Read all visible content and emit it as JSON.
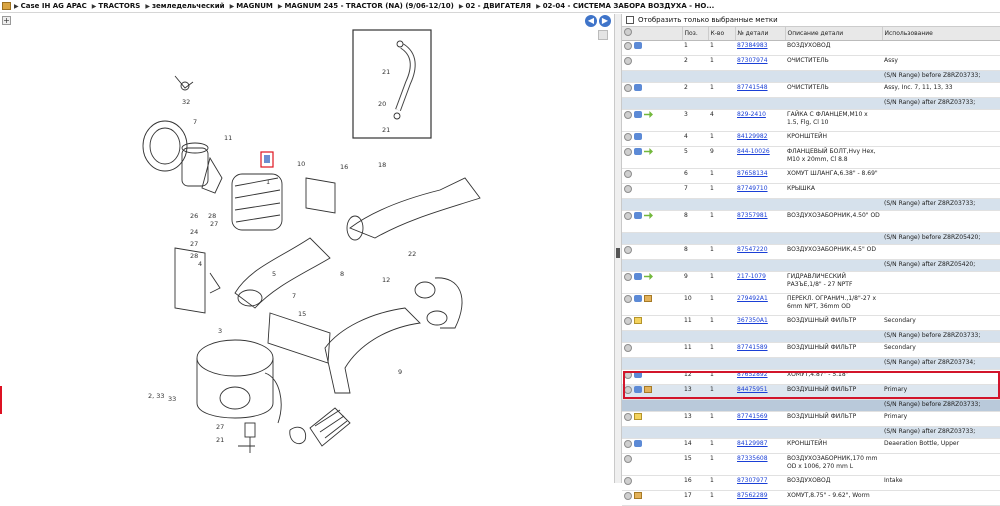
{
  "breadcrumb": {
    "items": [
      "Case IH AG APAC",
      "TRACTORS",
      "земледельческий",
      "MAGNUM",
      "MAGNUM 245 - TRACTOR (NA) (9/06-12/10)",
      "02 - ДВИГАТЕЛЯ",
      "02-04 - СИСТЕМА ЗАБОРА ВОЗДУХА - НО..."
    ]
  },
  "diagram": {
    "labels": [
      "32",
      "7",
      "11",
      "1",
      "10",
      "16",
      "18",
      "8",
      "26",
      "24",
      "27",
      "28",
      "12",
      "22",
      "9",
      "7",
      "33",
      "3",
      "15",
      "27",
      "21",
      "5",
      "4",
      "2, 33",
      "21",
      "20",
      "21",
      "28",
      "27"
    ],
    "selected_ref": "1"
  },
  "filter": {
    "label": "Отобразить только выбранные метки"
  },
  "table": {
    "headers": [
      "",
      "Поз.",
      "К-во",
      "№ детали",
      "Описание детали",
      "Использование"
    ],
    "rows": [
      {
        "icons": [
          "add",
          "sw"
        ],
        "pos": "1",
        "qty": "1",
        "part": "87384983",
        "desc": "ВОЗДУХОВОД",
        "use": "",
        "type": "row"
      },
      {
        "icons": [
          "add"
        ],
        "pos": "2",
        "qty": "1",
        "part": "87307974",
        "desc": "ОЧИСТИТЕЛЬ",
        "use": "Assy",
        "type": "row"
      },
      {
        "type": "note",
        "text": "(S/N Range) before Z8RZ03733;"
      },
      {
        "icons": [
          "add",
          "sw"
        ],
        "pos": "2",
        "qty": "1",
        "part": "87741548",
        "desc": "ОЧИСТИТЕЛЬ",
        "use": "Assy, Inc. 7, 11, 13, 33",
        "type": "row"
      },
      {
        "type": "note",
        "text": "(S/N Range) after Z8RZ03733;"
      },
      {
        "icons": [
          "add",
          "sw",
          "up"
        ],
        "pos": "3",
        "qty": "4",
        "part": "829-2410",
        "desc": "ГАЙКА С ФЛАНЦЕМ,M10 x 1.5, Flg, Cl 10",
        "use": "",
        "type": "row two"
      },
      {
        "icons": [
          "add",
          "sw"
        ],
        "pos": "4",
        "qty": "1",
        "part": "84129982",
        "desc": "КРОНШТЕЙН",
        "use": "",
        "type": "row"
      },
      {
        "icons": [
          "add",
          "sw",
          "up"
        ],
        "pos": "5",
        "qty": "9",
        "part": "844-10026",
        "desc": "ФЛАНЦЕВЫЙ БОЛТ,Hvy Hex, M10 x 20mm, Cl 8.8",
        "use": "",
        "type": "row two"
      },
      {
        "icons": [
          "add"
        ],
        "pos": "6",
        "qty": "1",
        "part": "87658134",
        "desc": "ХОМУТ ШЛАНГА,6.38\" - 8.69\"",
        "use": "",
        "type": "row"
      },
      {
        "icons": [
          "add"
        ],
        "pos": "7",
        "qty": "1",
        "part": "87749710",
        "desc": "КРЫШКА",
        "use": "",
        "type": "row"
      },
      {
        "type": "note",
        "text": "(S/N Range) after Z8RZ03733;"
      },
      {
        "icons": [
          "add",
          "sw",
          "up"
        ],
        "pos": "8",
        "qty": "1",
        "part": "87357981",
        "desc": "ВОЗДУХОЗАБОРНИК,4.50\" OD",
        "use": "",
        "type": "row two"
      },
      {
        "type": "note",
        "text": "(S/N Range) before Z8RZ05420;"
      },
      {
        "icons": [
          "add"
        ],
        "pos": "8",
        "qty": "1",
        "part": "87547220",
        "desc": "ВОЗДУХОЗАБОРНИК,4.5\" OD",
        "use": "",
        "type": "row"
      },
      {
        "type": "note",
        "text": "(S/N Range) after Z8RZ05420;"
      },
      {
        "icons": [
          "add",
          "sw",
          "up"
        ],
        "pos": "9",
        "qty": "1",
        "part": "217-1079",
        "desc": "ГИДРАВЛИЧЕСКИЙ РАЗЪЕ,1/8\" - 27 NPTF",
        "use": "",
        "type": "row two"
      },
      {
        "icons": [
          "add",
          "sw",
          "box"
        ],
        "pos": "10",
        "qty": "1",
        "part": "279492A1",
        "desc": "ПЕРЕКЛ. ОГРАНИЧ.,1/8\"-27 x 6mm NPT, 36mm OD",
        "use": "",
        "type": "row two"
      },
      {
        "icons": [
          "add",
          "note"
        ],
        "pos": "11",
        "qty": "1",
        "part": "367350A1",
        "desc": "ВОЗДУШНЫЙ ФИЛЬТР",
        "use": "Secondary",
        "type": "row"
      },
      {
        "type": "note",
        "text": "(S/N Range) before Z8RZ03733;"
      },
      {
        "icons": [
          "add"
        ],
        "pos": "11",
        "qty": "1",
        "part": "87741589",
        "desc": "ВОЗДУШНЫЙ ФИЛЬТР",
        "use": "Secondary",
        "type": "row"
      },
      {
        "type": "note",
        "text": "(S/N Range) after Z8RZ03734;"
      },
      {
        "icons": [
          "add",
          "sw"
        ],
        "pos": "12",
        "qty": "1",
        "part": "87652892",
        "desc": "ХОМУТ,4.87\" - 5.18\"",
        "use": "",
        "type": "row"
      },
      {
        "icons": [
          "add",
          "sw",
          "box"
        ],
        "pos": "13",
        "qty": "1",
        "part": "84475951",
        "desc": "ВОЗДУШНЫЙ ФИЛЬТР",
        "use": "Primary",
        "type": "row hl"
      },
      {
        "type": "note hl-note",
        "text": "(S/N Range) before Z8RZ03733;"
      },
      {
        "icons": [
          "add",
          "note"
        ],
        "pos": "13",
        "qty": "1",
        "part": "87741569",
        "desc": "ВОЗДУШНЫЙ ФИЛЬТР",
        "use": "Primary",
        "type": "row"
      },
      {
        "type": "note",
        "text": "(S/N Range) after Z8RZ03733;"
      },
      {
        "icons": [
          "add",
          "sw"
        ],
        "pos": "14",
        "qty": "1",
        "part": "84129987",
        "desc": "КРОНШТЕЙН",
        "use": "Deaeration Bottle, Upper",
        "type": "row"
      },
      {
        "icons": [
          "add"
        ],
        "pos": "15",
        "qty": "1",
        "part": "87335608",
        "desc": "ВОЗДУХОЗАБОРНИК,170 mm OD x 1006, 270 mm L",
        "use": "",
        "type": "row two"
      },
      {
        "icons": [
          "add"
        ],
        "pos": "16",
        "qty": "1",
        "part": "87307977",
        "desc": "ВОЗДУХОВОД",
        "use": "Intake",
        "type": "row"
      },
      {
        "icons": [
          "add",
          "box"
        ],
        "pos": "17",
        "qty": "1",
        "part": "87562289",
        "desc": "ХОМУТ,8.75\" - 9.62\", Worm",
        "use": "",
        "type": "row"
      }
    ]
  }
}
